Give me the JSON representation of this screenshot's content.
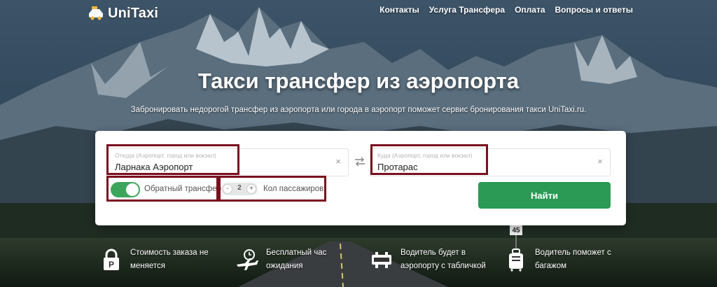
{
  "brand": {
    "name": "UniTaxi"
  },
  "nav": {
    "items": [
      {
        "label": "Контакты"
      },
      {
        "label": "Услуга Трансфера"
      },
      {
        "label": "Оплата"
      },
      {
        "label": "Вопросы и ответы"
      }
    ]
  },
  "hero": {
    "title": "Такси трансфер из аэропорта",
    "subtitle": "Забронировать недорогой трансфер из аэропорта или города в аэропорт поможет сервис бронирования такси UniTaxi.ru."
  },
  "booking": {
    "from": {
      "placeholder": "Откуда (Аэропорт, город или вокзал)",
      "value": "Ларнака Аэропорт"
    },
    "to": {
      "placeholder": "Куда (Аэропорт, город или вокзал)",
      "value": "Протарас"
    },
    "return_transfer": {
      "label": "Обратный трансфер",
      "enabled": true
    },
    "passengers": {
      "minus": "-",
      "plus": "+",
      "count": "2",
      "label": "Кол пассажиров"
    },
    "submit_label": "Найти"
  },
  "features": [
    {
      "icon": "price-lock-icon",
      "line1": "Стоимость заказа не",
      "line2": "меняется"
    },
    {
      "icon": "plane-clock-icon",
      "line1": "Бесплатный час",
      "line2": "ожидания"
    },
    {
      "icon": "sign-board-icon",
      "line1": "Водитель будет в",
      "line2": "аэропорту с табличкой"
    },
    {
      "icon": "luggage-icon",
      "line1": "Водитель поможет с",
      "line2": "багажом"
    }
  ],
  "colors": {
    "accent": "#2a9a55",
    "annotation": "#7a0f1f",
    "toggle_on": "#3ca55c"
  }
}
